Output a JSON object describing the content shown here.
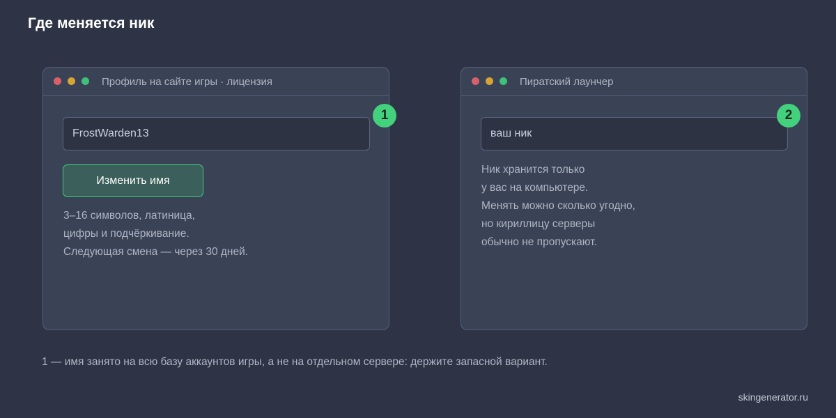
{
  "page": {
    "title": "Где меняется ник",
    "footnote": "1 — имя занято на всю базу аккаунтов игры, а не на отдельном сервере: держите запасной вариант.",
    "site": "skingenerator.ru"
  },
  "colors": {
    "background": "#2e3445",
    "window": "#3a4256",
    "accent_green": "#44d17e",
    "button_bg": "#3b5f5a",
    "dot_red": "#d9606b",
    "dot_yellow": "#d6a431",
    "dot_green": "#3fc07a"
  },
  "windows": [
    {
      "title": "Профиль на сайте игры · лицензия",
      "field_value": "FrostWarden13",
      "button_label": "Изменить имя",
      "hint_lines": [
        "3–16 символов, латиница,",
        "цифры и подчёркивание.",
        "Следующая смена — через 30 дней."
      ],
      "badge": "1"
    },
    {
      "title": "Пиратский лаунчер",
      "field_value": "ваш ник",
      "hint_lines": [
        "Ник хранится только",
        "у вас на компьютере.",
        "Менять можно сколько угодно,",
        "но кириллицу серверы",
        "обычно не пропускают."
      ],
      "badge": "2"
    }
  ]
}
